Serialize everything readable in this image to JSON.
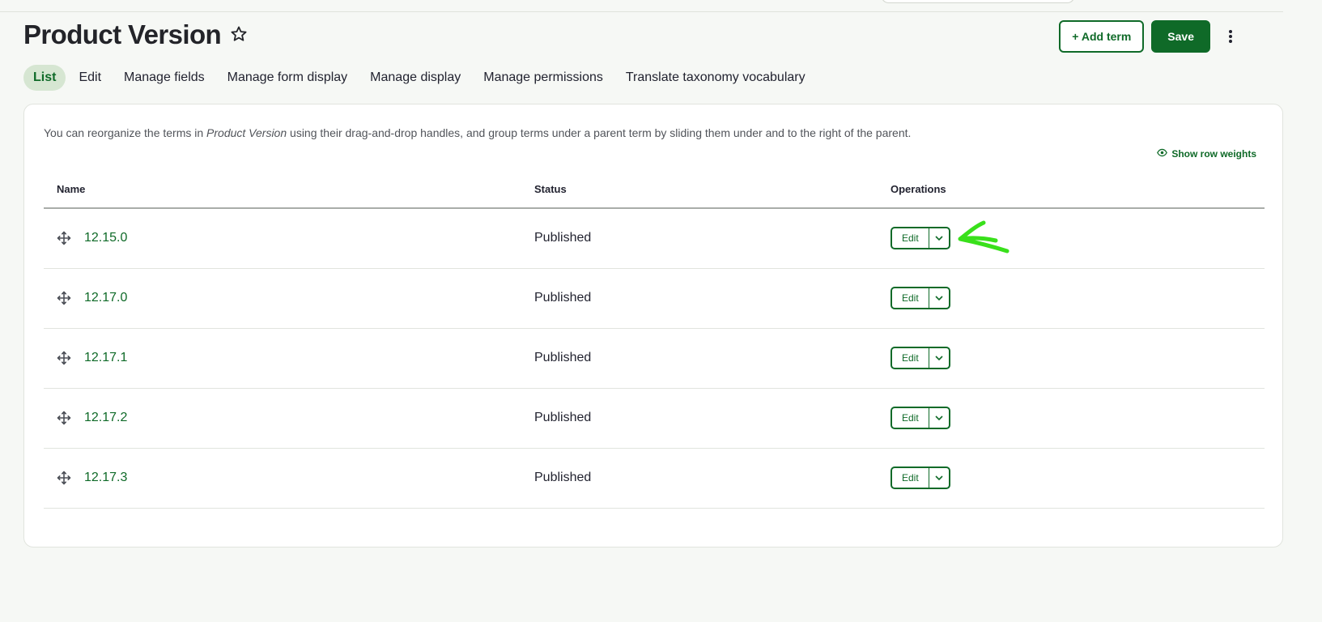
{
  "page": {
    "title": "Product Version"
  },
  "header_actions": {
    "add_term_label": "+ Add term",
    "save_label": "Save"
  },
  "tabs": [
    {
      "label": "List",
      "active": true
    },
    {
      "label": "Edit"
    },
    {
      "label": "Manage fields"
    },
    {
      "label": "Manage form display"
    },
    {
      "label": "Manage display"
    },
    {
      "label": "Manage permissions"
    },
    {
      "label": "Translate taxonomy vocabulary"
    }
  ],
  "help": {
    "before": "You can reorganize the terms in ",
    "emphasis": "Product Version",
    "after": " using their drag-and-drop handles, and group terms under a parent term by sliding them under and to the right of the parent."
  },
  "show_row_weights_label": "Show row weights",
  "table": {
    "headers": {
      "name": "Name",
      "status": "Status",
      "operations": "Operations"
    },
    "rows": [
      {
        "name": "12.15.0",
        "status": "Published",
        "op_label": "Edit"
      },
      {
        "name": "12.17.0",
        "status": "Published",
        "op_label": "Edit"
      },
      {
        "name": "12.17.1",
        "status": "Published",
        "op_label": "Edit"
      },
      {
        "name": "12.17.2",
        "status": "Published",
        "op_label": "Edit"
      },
      {
        "name": "12.17.3",
        "status": "Published",
        "op_label": "Edit"
      }
    ]
  },
  "icons": {
    "star": "star-icon",
    "kebab": "kebab-menu-icon",
    "eye": "eye-icon",
    "drag": "drag-handle-icon",
    "chevron": "chevron-down-icon",
    "annotation": "green-arrow-annotation"
  },
  "colors": {
    "accent": "#0f6a28",
    "active_tab_bg": "#d6e6d2",
    "annotation": "#39e01b"
  }
}
